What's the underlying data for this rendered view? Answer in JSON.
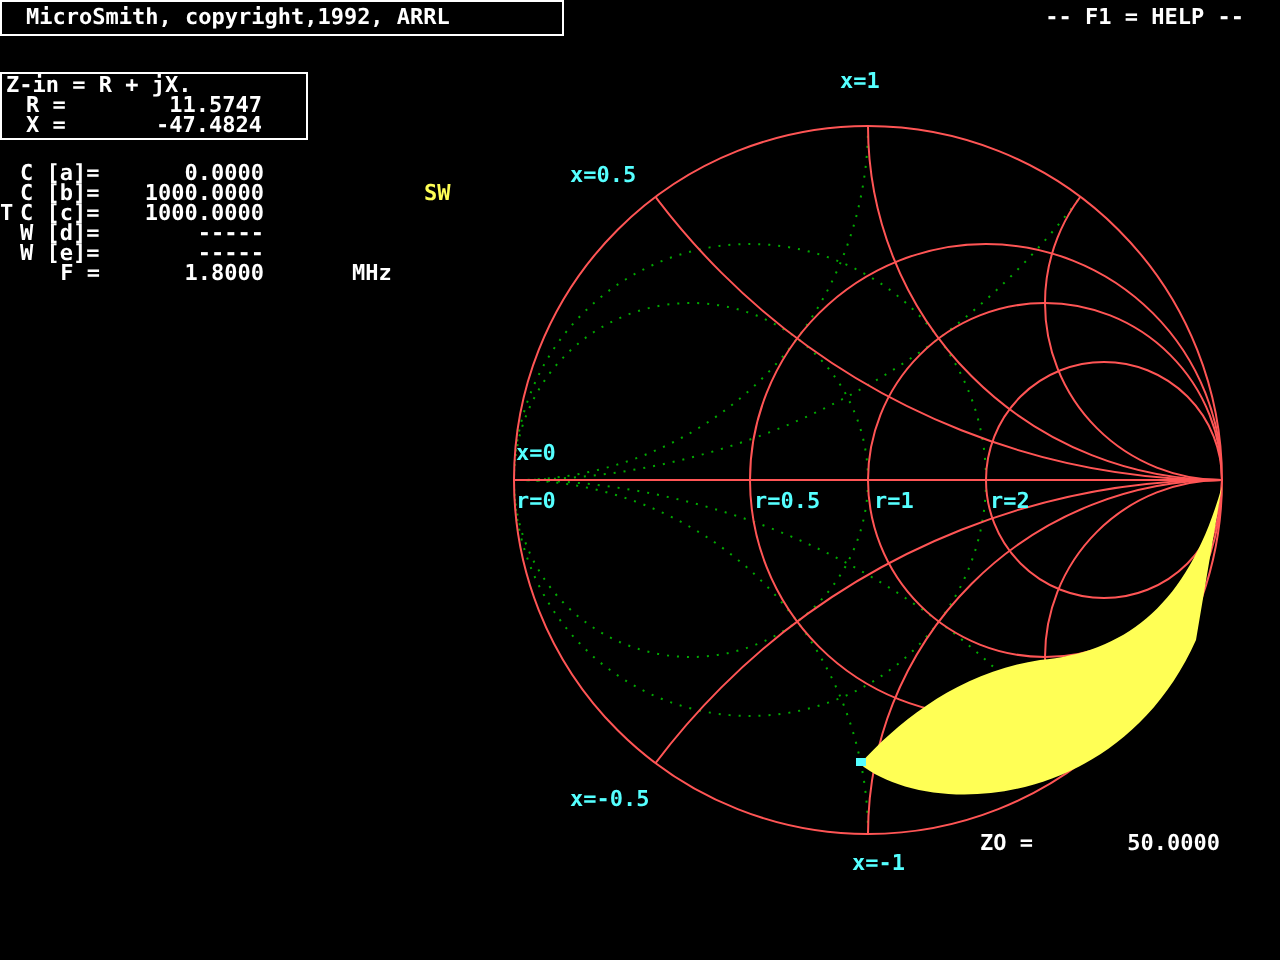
{
  "title_bar": {
    "text": "MicroSmith, copyright,1992, ARRL"
  },
  "help_hint": "-- F1 = HELP --",
  "impedance": {
    "heading": "Z-in = R + jX.",
    "rows": [
      {
        "label": "R =",
        "value": "11.5747"
      },
      {
        "label": "X =",
        "value": "-47.4824"
      }
    ]
  },
  "parameters": [
    {
      "label": "C [a]=",
      "value": "0.0000"
    },
    {
      "label": "C [b]=",
      "value": "1000.0000",
      "flag": "SW"
    },
    {
      "label": "C [c]=",
      "value": "1000.0000",
      "marker": "T"
    },
    {
      "label": "W [d]=",
      "value": "-----"
    },
    {
      "label": "W [e]=",
      "value": "-----"
    },
    {
      "label": "F =",
      "value": "1.8000",
      "unit": "MHz"
    }
  ],
  "chart": {
    "labels": [
      "x=1",
      "x=0.5",
      "x=0",
      "r=0",
      "r=0.5",
      "r=1",
      "r=2",
      "x=-0.5",
      "x=-1"
    ],
    "z0_label": "ZO =",
    "z0_value": "50.0000"
  }
}
